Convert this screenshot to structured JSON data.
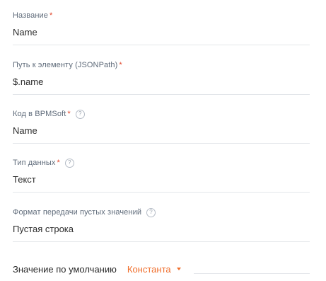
{
  "fields": [
    {
      "label": "Название",
      "required": "*",
      "value": "Name"
    },
    {
      "label": "Путь к элементу (JSONPath)",
      "required": "*",
      "value": "$.name"
    },
    {
      "label": "Код в BPMSoft",
      "required": "*",
      "help": "?",
      "value": "Name"
    },
    {
      "label": "Тип данных",
      "required": "*",
      "help": "?",
      "value": "Текст"
    },
    {
      "label": "Формат передачи пустых значений",
      "help": "?",
      "value": "Пустая строка"
    }
  ],
  "default_value": {
    "label": "Значение по умолчанию",
    "mode": "Константа",
    "value": ""
  },
  "colors": {
    "accent": "#f06e2c",
    "required": "#e0452a",
    "label": "#5f6b7a",
    "divider": "#e3e6ea"
  }
}
